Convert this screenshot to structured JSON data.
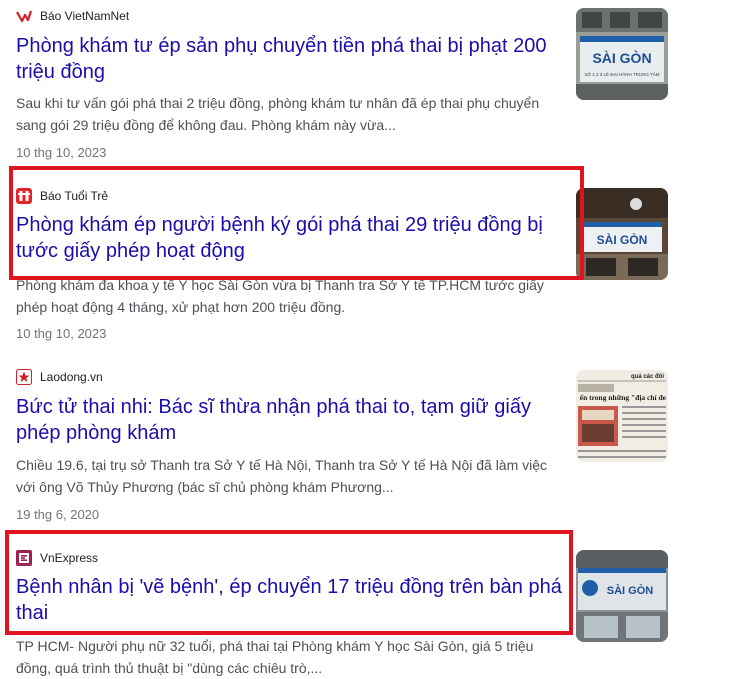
{
  "results": [
    {
      "source": "Báo VietNamNet",
      "source_icon": "vietnamnet-logo-icon",
      "title": "Phòng khám tư ép sản phụ chuyển tiền phá thai bị phạt 200 triệu đồng",
      "snippet": "Sau khi tư vấn gói phá thai 2 triệu đồng, phòng khám tư nhân đã ép thai phụ chuyển sang gói 29 triệu đồng để không đau. Phòng khám này vừa...",
      "date": "10 thg 10, 2023",
      "thumb_sign": "SÀI GÒN",
      "thumb_small": "SỐ 1 2 3 LÊ ĐẠI HÀNH TRUNG TÂM"
    },
    {
      "source": "Báo Tuổi Trẻ",
      "source_icon": "tuoitre-logo-icon",
      "title": "Phòng khám ép người bệnh ký gói phá thai 29 triệu đồng bị tước giấy phép hoạt động",
      "snippet": "Phòng khám đa khoa y tế Y học Sài Gòn vừa bị Thanh tra Sở Y tế TP.HCM tước giấy phép hoạt động 4 tháng, xử phạt hơn 200 triệu đồng.",
      "date": "10 thg 10, 2023",
      "thumb_sign": "SÀI GÒN"
    },
    {
      "source": "Laodong.vn",
      "source_icon": "laodong-logo-icon",
      "title": "Bức tử thai nhi: Bác sĩ thừa nhận phá thai to, tạm giữ giấy phép phòng khám",
      "snippet": "Chiều 19.6, tại trụ sở Thanh tra Sở Y tế Hà Nội, Thanh tra Sở Y tế Hà Nội đã làm việc với ông Võ Thủy Phương (bác sĩ chủ phòng khám Phương...",
      "date": "19 thg 6, 2020",
      "thumb_top": "quá các đôi",
      "thumb_headline": "ến trong những \"địa chỉ đe"
    },
    {
      "source": "VnExpress",
      "source_icon": "vnexpress-logo-icon",
      "title": "Bệnh nhân bị 'vẽ bệnh', ép chuyển 17 triệu đồng trên bàn phá thai",
      "snippet": "TP HCM- Người phụ nữ 32 tuổi, phá thai tại Phòng khám Y học Sài Gòn, giá 5 triệu đồng, quá trình thủ thuật bị \"dùng các chiêu trò,...",
      "thumb_sign": "SÀI GÒN"
    }
  ],
  "colors": {
    "title": "#1a0dab",
    "snippet": "#4d5156",
    "date": "#70757a",
    "highlight": "#e0131f"
  }
}
